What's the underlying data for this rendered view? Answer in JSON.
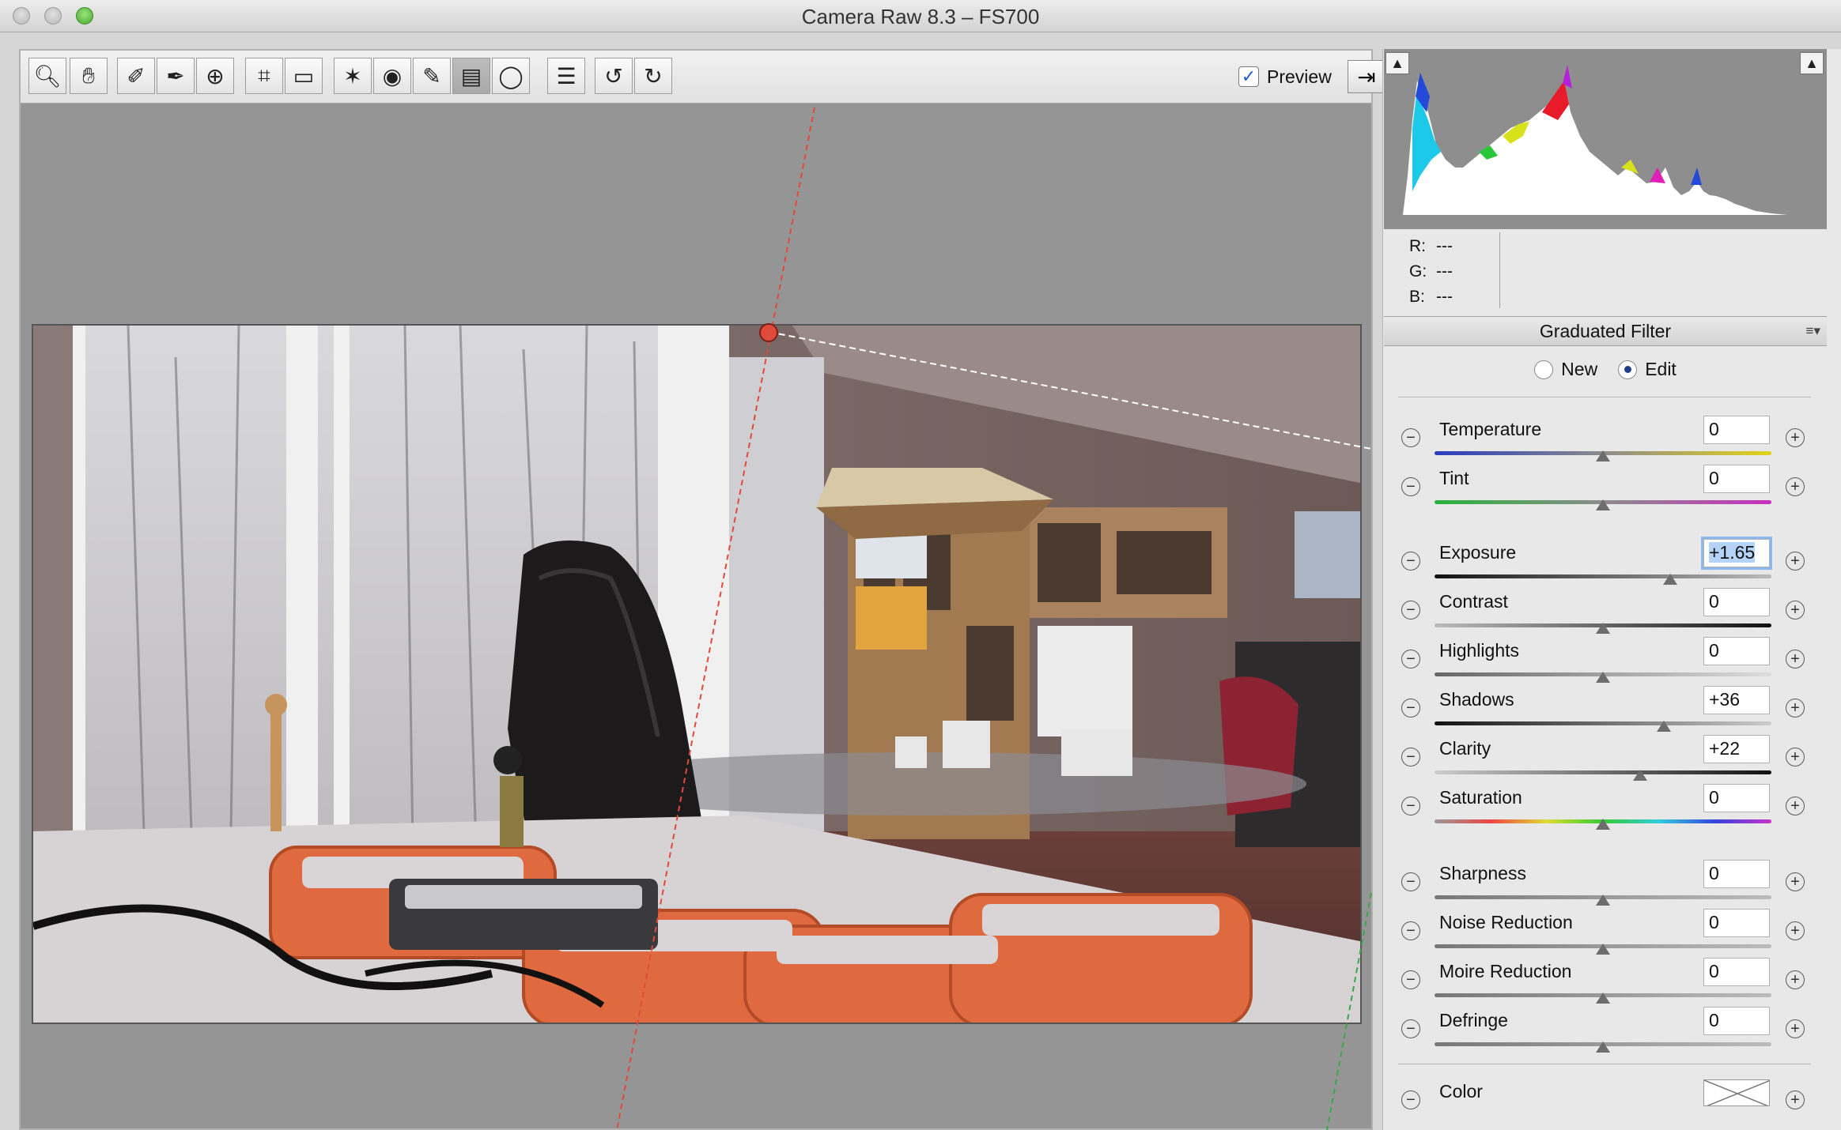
{
  "window": {
    "title": "Camera Raw 8.3  –  FS700"
  },
  "toolbar": {
    "tools": [
      "zoom-tool",
      "hand-tool",
      "white-balance-tool",
      "color-sampler-tool",
      "targeted-adjustment-tool",
      "crop-tool",
      "straighten-tool",
      "spot-removal-tool",
      "red-eye-tool",
      "adjustment-brush-tool",
      "graduated-filter-tool",
      "radial-filter-tool",
      "preferences-tool",
      "rotate-ccw-tool",
      "rotate-cw-tool"
    ],
    "preview_label": "Preview",
    "preview_checked": true
  },
  "histogram": {
    "r_label": "R:",
    "g_label": "G:",
    "b_label": "B:",
    "r_value": "---",
    "g_value": "---",
    "b_value": "---"
  },
  "panel": {
    "title": "Graduated Filter",
    "mode_new": "New",
    "mode_edit": "Edit",
    "selected_mode": "Edit"
  },
  "sliders": [
    {
      "label": "Temperature",
      "value": "0",
      "position": 0.5,
      "group": 1
    },
    {
      "label": "Tint",
      "value": "0",
      "position": 0.5,
      "group": 1
    },
    {
      "label": "Exposure",
      "value": "+1.65",
      "position": 0.7,
      "group": 2,
      "selected": true
    },
    {
      "label": "Contrast",
      "value": "0",
      "position": 0.5,
      "group": 2
    },
    {
      "label": "Highlights",
      "value": "0",
      "position": 0.5,
      "group": 2
    },
    {
      "label": "Shadows",
      "value": "+36",
      "position": 0.68,
      "group": 2
    },
    {
      "label": "Clarity",
      "value": "+22",
      "position": 0.61,
      "group": 2
    },
    {
      "label": "Saturation",
      "value": "0",
      "position": 0.5,
      "group": 2
    },
    {
      "label": "Sharpness",
      "value": "0",
      "position": 0.5,
      "group": 3
    },
    {
      "label": "Noise Reduction",
      "value": "0",
      "position": 0.5,
      "group": 3
    },
    {
      "label": "Moire Reduction",
      "value": "0",
      "position": 0.5,
      "group": 3
    },
    {
      "label": "Defringe",
      "value": "0",
      "position": 0.5,
      "group": 3
    }
  ],
  "color_row": {
    "label": "Color"
  },
  "colors": {
    "accent": "#1d3f8a",
    "filter_start": "#e04a3a",
    "filter_end": "#3aa84a"
  }
}
